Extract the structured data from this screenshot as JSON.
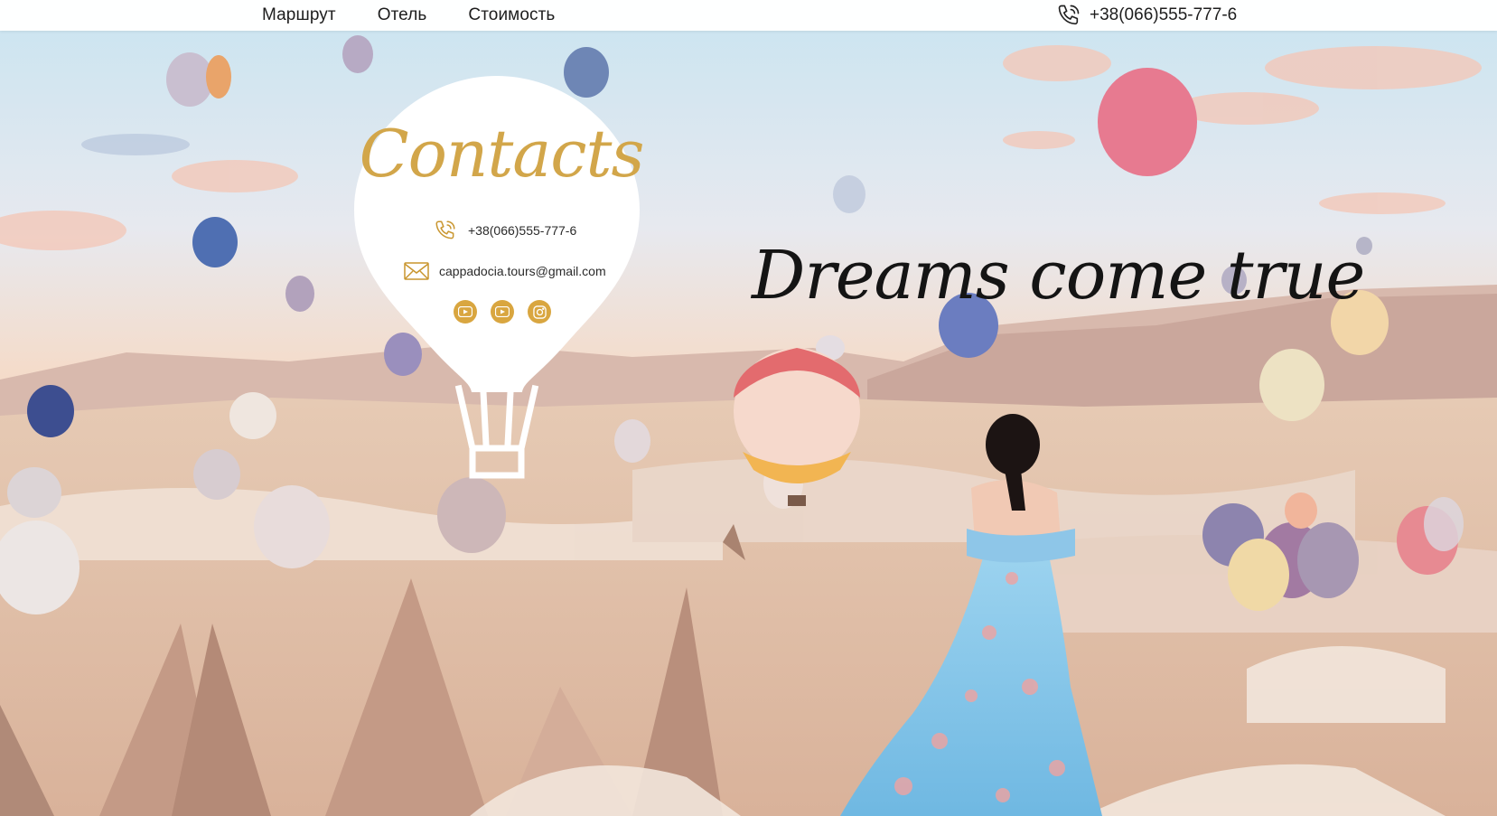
{
  "nav": {
    "items": [
      {
        "label": "Маршрут"
      },
      {
        "label": "Отель"
      },
      {
        "label": "Стоимость"
      }
    ],
    "phone": "+38(066)555-777-6",
    "phone_icon": "phone-icon"
  },
  "contacts": {
    "title": "Contacts",
    "phone": "+38(066)555-777-6",
    "email": "cappadocia.tours@gmail.com",
    "socials": [
      {
        "icon": "youtube-icon"
      },
      {
        "icon": "youtube-icon"
      },
      {
        "icon": "instagram-icon"
      }
    ]
  },
  "hero": {
    "tagline": "Dreams come true"
  },
  "colors": {
    "accent_gold": "#d9a640",
    "title_gold": "#d2a64a",
    "text_dark": "#1d1d1d"
  }
}
